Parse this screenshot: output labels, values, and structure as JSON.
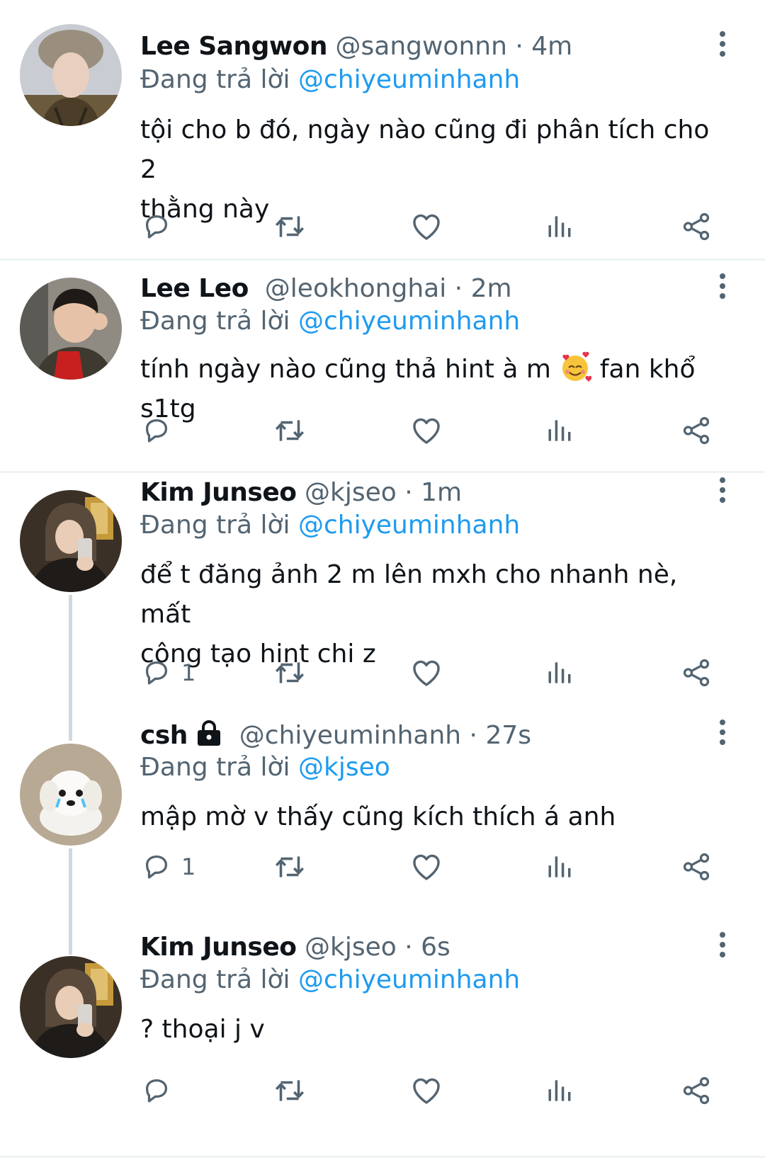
{
  "colors": {
    "accent": "#1d9bf0",
    "secondary_text": "#536471",
    "divider": "#eff3f4"
  },
  "tweets": [
    {
      "name": "Lee Sangwon",
      "handle": "@sangwonnn",
      "time": "4m",
      "replying_prefix": "Đang trả lời ",
      "replying_to": "@chiyeuminhanh",
      "text_line1": "tội cho b đó, ngày nào cũng đi phân tích cho 2",
      "text_line2": "thằng này",
      "reply_count": ""
    },
    {
      "name": "Lee Leo",
      "handle": "@leokhonghai",
      "time": "2m",
      "replying_prefix": "Đang trả lời ",
      "replying_to": "@chiyeuminhanh",
      "text_before_emoji": "tính ngày nào cũng thả hint à m ",
      "emoji_icon": "smiling-face-with-hearts-icon",
      "text_after_emoji": " fan khổ s1tg",
      "reply_count": ""
    },
    {
      "name": "Kim Junseo",
      "handle": "@kjseo",
      "time": "1m",
      "replying_prefix": "Đang trả lời ",
      "replying_to": "@chiyeuminhanh",
      "text_line1": "để t đăng ảnh 2 m lên mxh cho nhanh nè, mất",
      "text_line2": "công tạo hint chi z",
      "reply_count": "1"
    },
    {
      "name": "csh",
      "handle": "@chiyeuminhanh",
      "time": "27s",
      "replying_prefix": "Đang trả lời ",
      "replying_to": "@kjseo",
      "text_line1": "mập mờ v thấy cũng kích thích á anh",
      "reply_count": "1"
    },
    {
      "name": "Kim Junseo",
      "handle": "@kjseo",
      "time": "6s",
      "replying_prefix": "Đang trả lời ",
      "replying_to": "@chiyeuminhanh",
      "text_line1": "? thoại j v",
      "reply_count": ""
    }
  ],
  "separator": "·"
}
